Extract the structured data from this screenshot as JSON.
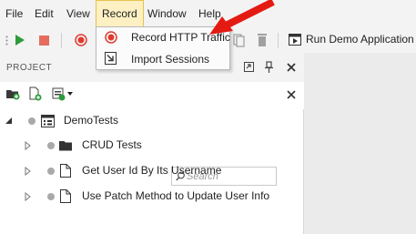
{
  "menubar": {
    "items": [
      "File",
      "Edit",
      "View",
      "Record",
      "Window",
      "Help"
    ],
    "active": "Record"
  },
  "record_menu": {
    "items": [
      {
        "label": "Record HTTP Traffic",
        "icon": "record-icon"
      },
      {
        "label": "Import Sessions",
        "icon": "import-icon"
      }
    ]
  },
  "toolbar": {
    "run_demo_label": "Run Demo Application"
  },
  "panel": {
    "title": "PROJECT",
    "search_placeholder": "Search"
  },
  "tree": {
    "root": "DemoTests",
    "children": [
      {
        "label": "CRUD Tests",
        "type": "folder"
      },
      {
        "label": "Get User Id By Its Username",
        "type": "test"
      },
      {
        "label": "Use Patch Method to Update User Info",
        "type": "test"
      }
    ]
  },
  "colors": {
    "accent_red": "#e03a2f",
    "run_green": "#2e9b3a",
    "menu_active": "#fdf0c3",
    "arrow_red": "#e41b13"
  }
}
